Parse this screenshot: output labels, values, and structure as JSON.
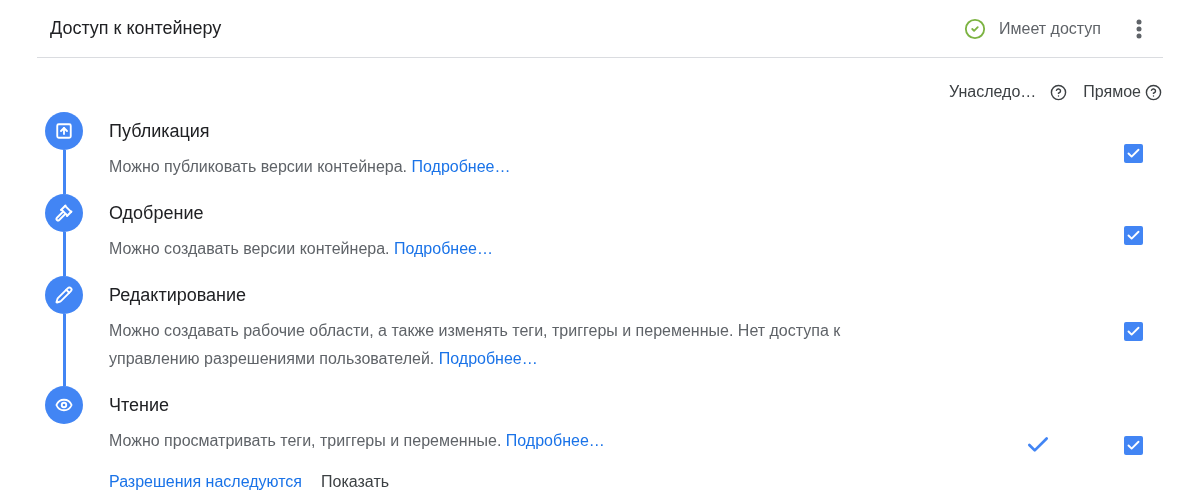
{
  "header": {
    "title": "Доступ к контейнеру",
    "status": "Имеет доступ"
  },
  "columns": [
    {
      "label": "Унаследо…"
    },
    {
      "label": "Прямое"
    }
  ],
  "permissions": [
    {
      "kind": "publish",
      "title": "Публикация",
      "description": "Можно публиковать версии контейнера.",
      "link": "Подробнее…",
      "inherited": false,
      "direct": true
    },
    {
      "kind": "approve",
      "title": "Одобрение",
      "description": "Можно создавать версии контейнера.",
      "link": "Подробнее…",
      "inherited": false,
      "direct": true
    },
    {
      "kind": "edit",
      "title": "Редактирование",
      "description": "Можно создавать рабочие области, а также изменять теги, триггеры и переменные. Нет доступа к управлению разрешениями пользователей.",
      "link": "Подробнее…",
      "inherited": false,
      "direct": true
    },
    {
      "kind": "read",
      "title": "Чтение",
      "description": "Можно просматривать теги, триггеры и переменные.",
      "link": "Подробнее…",
      "inherited": true,
      "direct": true
    }
  ],
  "footer": {
    "link": "Разрешения наследуются",
    "button": "Показать"
  }
}
